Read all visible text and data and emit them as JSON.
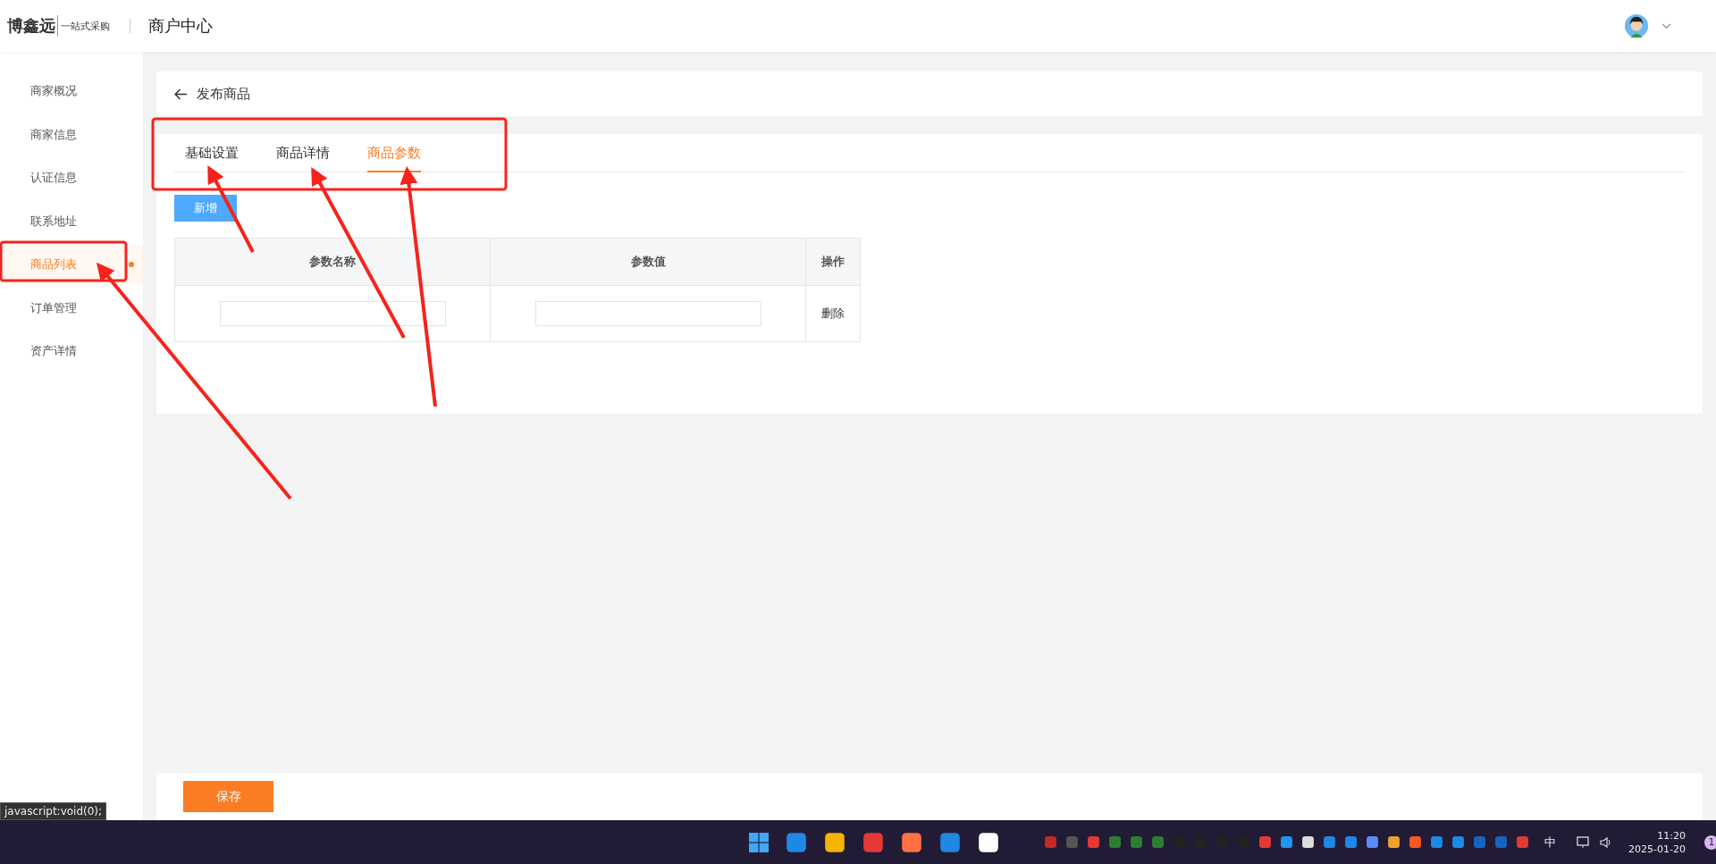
{
  "header": {
    "logo": "博鑫远",
    "slogan": "一站式采购",
    "title": "商户中心"
  },
  "sidebar": {
    "items": [
      {
        "label": "商家概况",
        "selected": false
      },
      {
        "label": "商家信息",
        "selected": false
      },
      {
        "label": "认证信息",
        "selected": false
      },
      {
        "label": "联系地址",
        "selected": false
      },
      {
        "label": "商品列表",
        "selected": true
      },
      {
        "label": "订单管理",
        "selected": false
      },
      {
        "label": "资产详情",
        "selected": false
      }
    ]
  },
  "page": {
    "title": "发布商品"
  },
  "tabs": [
    {
      "label": "基础设置",
      "selected": false
    },
    {
      "label": "商品详情",
      "selected": false
    },
    {
      "label": "商品参数",
      "selected": true
    }
  ],
  "add_button": "新增",
  "table": {
    "columns": [
      "参数名称",
      "参数值",
      "操作"
    ],
    "rows": [
      {
        "action": "删除"
      }
    ]
  },
  "save_button": "保存",
  "status_link": "javascript:void(0);",
  "taskbar": {
    "ime": "中",
    "time": "11:20",
    "date": "2025-01-20",
    "notifications": "1"
  }
}
